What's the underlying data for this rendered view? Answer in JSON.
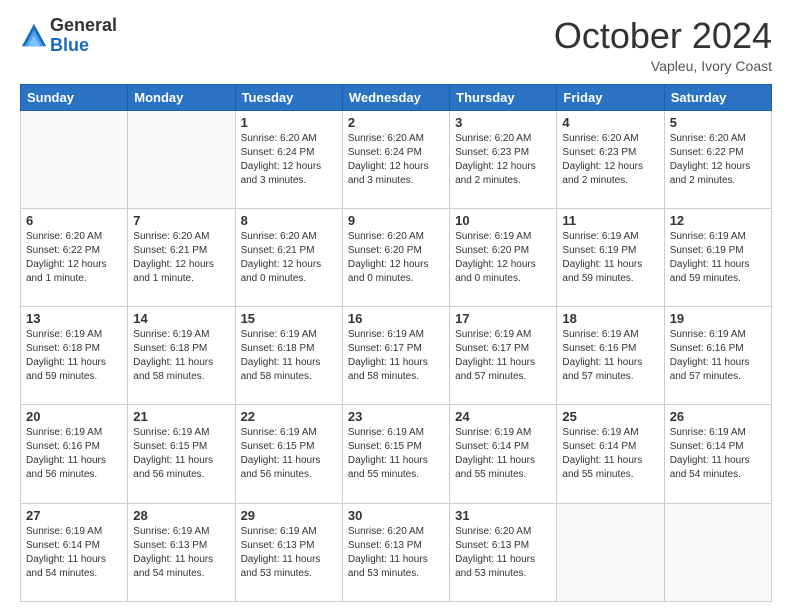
{
  "logo": {
    "general": "General",
    "blue": "Blue"
  },
  "header": {
    "month": "October 2024",
    "location": "Vapleu, Ivory Coast"
  },
  "weekdays": [
    "Sunday",
    "Monday",
    "Tuesday",
    "Wednesday",
    "Thursday",
    "Friday",
    "Saturday"
  ],
  "weeks": [
    [
      {
        "day": "",
        "info": ""
      },
      {
        "day": "",
        "info": ""
      },
      {
        "day": "1",
        "info": "Sunrise: 6:20 AM\nSunset: 6:24 PM\nDaylight: 12 hours\nand 3 minutes."
      },
      {
        "day": "2",
        "info": "Sunrise: 6:20 AM\nSunset: 6:24 PM\nDaylight: 12 hours\nand 3 minutes."
      },
      {
        "day": "3",
        "info": "Sunrise: 6:20 AM\nSunset: 6:23 PM\nDaylight: 12 hours\nand 2 minutes."
      },
      {
        "day": "4",
        "info": "Sunrise: 6:20 AM\nSunset: 6:23 PM\nDaylight: 12 hours\nand 2 minutes."
      },
      {
        "day": "5",
        "info": "Sunrise: 6:20 AM\nSunset: 6:22 PM\nDaylight: 12 hours\nand 2 minutes."
      }
    ],
    [
      {
        "day": "6",
        "info": "Sunrise: 6:20 AM\nSunset: 6:22 PM\nDaylight: 12 hours\nand 1 minute."
      },
      {
        "day": "7",
        "info": "Sunrise: 6:20 AM\nSunset: 6:21 PM\nDaylight: 12 hours\nand 1 minute."
      },
      {
        "day": "8",
        "info": "Sunrise: 6:20 AM\nSunset: 6:21 PM\nDaylight: 12 hours\nand 0 minutes."
      },
      {
        "day": "9",
        "info": "Sunrise: 6:20 AM\nSunset: 6:20 PM\nDaylight: 12 hours\nand 0 minutes."
      },
      {
        "day": "10",
        "info": "Sunrise: 6:19 AM\nSunset: 6:20 PM\nDaylight: 12 hours\nand 0 minutes."
      },
      {
        "day": "11",
        "info": "Sunrise: 6:19 AM\nSunset: 6:19 PM\nDaylight: 11 hours\nand 59 minutes."
      },
      {
        "day": "12",
        "info": "Sunrise: 6:19 AM\nSunset: 6:19 PM\nDaylight: 11 hours\nand 59 minutes."
      }
    ],
    [
      {
        "day": "13",
        "info": "Sunrise: 6:19 AM\nSunset: 6:18 PM\nDaylight: 11 hours\nand 59 minutes."
      },
      {
        "day": "14",
        "info": "Sunrise: 6:19 AM\nSunset: 6:18 PM\nDaylight: 11 hours\nand 58 minutes."
      },
      {
        "day": "15",
        "info": "Sunrise: 6:19 AM\nSunset: 6:18 PM\nDaylight: 11 hours\nand 58 minutes."
      },
      {
        "day": "16",
        "info": "Sunrise: 6:19 AM\nSunset: 6:17 PM\nDaylight: 11 hours\nand 58 minutes."
      },
      {
        "day": "17",
        "info": "Sunrise: 6:19 AM\nSunset: 6:17 PM\nDaylight: 11 hours\nand 57 minutes."
      },
      {
        "day": "18",
        "info": "Sunrise: 6:19 AM\nSunset: 6:16 PM\nDaylight: 11 hours\nand 57 minutes."
      },
      {
        "day": "19",
        "info": "Sunrise: 6:19 AM\nSunset: 6:16 PM\nDaylight: 11 hours\nand 57 minutes."
      }
    ],
    [
      {
        "day": "20",
        "info": "Sunrise: 6:19 AM\nSunset: 6:16 PM\nDaylight: 11 hours\nand 56 minutes."
      },
      {
        "day": "21",
        "info": "Sunrise: 6:19 AM\nSunset: 6:15 PM\nDaylight: 11 hours\nand 56 minutes."
      },
      {
        "day": "22",
        "info": "Sunrise: 6:19 AM\nSunset: 6:15 PM\nDaylight: 11 hours\nand 56 minutes."
      },
      {
        "day": "23",
        "info": "Sunrise: 6:19 AM\nSunset: 6:15 PM\nDaylight: 11 hours\nand 55 minutes."
      },
      {
        "day": "24",
        "info": "Sunrise: 6:19 AM\nSunset: 6:14 PM\nDaylight: 11 hours\nand 55 minutes."
      },
      {
        "day": "25",
        "info": "Sunrise: 6:19 AM\nSunset: 6:14 PM\nDaylight: 11 hours\nand 55 minutes."
      },
      {
        "day": "26",
        "info": "Sunrise: 6:19 AM\nSunset: 6:14 PM\nDaylight: 11 hours\nand 54 minutes."
      }
    ],
    [
      {
        "day": "27",
        "info": "Sunrise: 6:19 AM\nSunset: 6:14 PM\nDaylight: 11 hours\nand 54 minutes."
      },
      {
        "day": "28",
        "info": "Sunrise: 6:19 AM\nSunset: 6:13 PM\nDaylight: 11 hours\nand 54 minutes."
      },
      {
        "day": "29",
        "info": "Sunrise: 6:19 AM\nSunset: 6:13 PM\nDaylight: 11 hours\nand 53 minutes."
      },
      {
        "day": "30",
        "info": "Sunrise: 6:20 AM\nSunset: 6:13 PM\nDaylight: 11 hours\nand 53 minutes."
      },
      {
        "day": "31",
        "info": "Sunrise: 6:20 AM\nSunset: 6:13 PM\nDaylight: 11 hours\nand 53 minutes."
      },
      {
        "day": "",
        "info": ""
      },
      {
        "day": "",
        "info": ""
      }
    ]
  ]
}
